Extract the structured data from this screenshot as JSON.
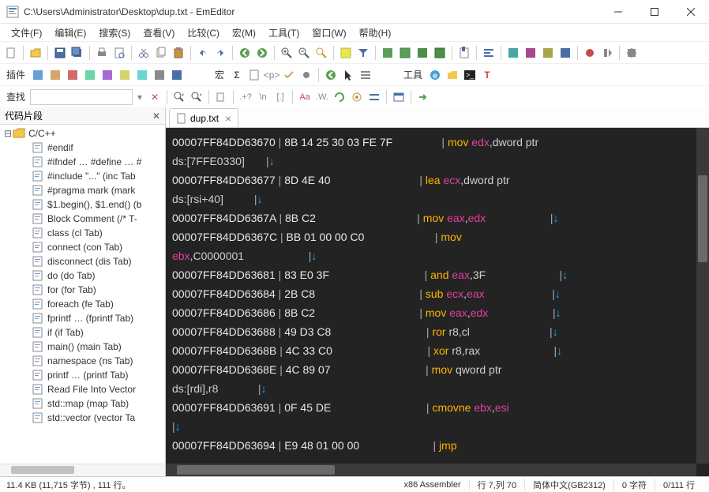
{
  "window": {
    "title": "C:\\Users\\Administrator\\Desktop\\dup.txt - EmEditor"
  },
  "menu": {
    "file": "文件(F)",
    "edit": "编辑(E)",
    "search": "搜索(S)",
    "view": "查看(V)",
    "compare": "比较(C)",
    "macro": "宏(M)",
    "tools": "工具(T)",
    "window": "窗口(W)",
    "help": "帮助(H)"
  },
  "toolbar2": {
    "plugin_label": "插件",
    "macro_label": "宏",
    "tools_label": "工具"
  },
  "toolbar3": {
    "find_label": "查找"
  },
  "snippets": {
    "header": "代码片段",
    "root": "C/C++",
    "items": [
      "#endif",
      "#ifndef … #define … #",
      "#include \"...\"  (inc Tab",
      "#pragma mark  (mark",
      "$1.begin(), $1.end()  (b",
      "Block Comment  (/* T-",
      "class  (cl Tab)",
      "connect  (con Tab)",
      "disconnect  (dis Tab)",
      "do  (do Tab)",
      "for  (for Tab)",
      "foreach  (fe Tab)",
      "fprintf …  (fprintf Tab)",
      "if  (if Tab)",
      "main()  (main Tab)",
      "namespace  (ns Tab)",
      "printf …  (printf Tab)",
      "Read File Into Vector",
      "std::map  (map Tab)",
      "std::vector  (vector Ta"
    ]
  },
  "tab": {
    "name": "dup.txt"
  },
  "editor_lines": [
    [
      {
        "t": "00007FF84DD63670 ",
        "c": "addr"
      },
      {
        "t": "| ",
        "c": "pipe"
      },
      {
        "t": "8B 14 25 30 03 FE 7F",
        "c": "hex"
      },
      {
        "t": "                | ",
        "c": "pipe"
      },
      {
        "t": "mov",
        "c": "mnm"
      },
      {
        "t": " ",
        "c": "lit"
      },
      {
        "t": "edx",
        "c": "reg"
      },
      {
        "t": ",dword ptr",
        "c": "mem"
      }
    ],
    [
      {
        "t": "ds:[7FFE0330]",
        "c": "mem"
      },
      {
        "t": "       |",
        "c": "pipe"
      },
      {
        "t": "↓",
        "c": "arr"
      }
    ],
    [
      {
        "t": "00007FF84DD63677 ",
        "c": "addr"
      },
      {
        "t": "| ",
        "c": "pipe"
      },
      {
        "t": "8D 4E 40",
        "c": "hex"
      },
      {
        "t": "                             | ",
        "c": "pipe"
      },
      {
        "t": "lea",
        "c": "mnm"
      },
      {
        "t": " ",
        "c": "lit"
      },
      {
        "t": "ecx",
        "c": "reg"
      },
      {
        "t": ",dword ptr",
        "c": "mem"
      }
    ],
    [
      {
        "t": "ds:[rsi+40]",
        "c": "mem"
      },
      {
        "t": "          |",
        "c": "pipe"
      },
      {
        "t": "↓",
        "c": "arr"
      }
    ],
    [
      {
        "t": "00007FF84DD6367A ",
        "c": "addr"
      },
      {
        "t": "| ",
        "c": "pipe"
      },
      {
        "t": "8B C2",
        "c": "hex"
      },
      {
        "t": "                                 | ",
        "c": "pipe"
      },
      {
        "t": "mov",
        "c": "mnm"
      },
      {
        "t": " ",
        "c": "lit"
      },
      {
        "t": "eax",
        "c": "reg"
      },
      {
        "t": ",",
        "c": "lit"
      },
      {
        "t": "edx",
        "c": "reg"
      },
      {
        "t": "                     |",
        "c": "pipe"
      },
      {
        "t": "↓",
        "c": "arr"
      }
    ],
    [
      {
        "t": "00007FF84DD6367C ",
        "c": "addr"
      },
      {
        "t": "| ",
        "c": "pipe"
      },
      {
        "t": "BB 01 00 00 C0",
        "c": "hex"
      },
      {
        "t": "                       | ",
        "c": "pipe"
      },
      {
        "t": "mov",
        "c": "mnm"
      }
    ],
    [
      {
        "t": "ebx",
        "c": "reg"
      },
      {
        "t": ",C0000001",
        "c": "lit"
      },
      {
        "t": "                     |",
        "c": "pipe"
      },
      {
        "t": "↓",
        "c": "arr"
      }
    ],
    [
      {
        "t": "00007FF84DD63681 ",
        "c": "addr"
      },
      {
        "t": "| ",
        "c": "pipe"
      },
      {
        "t": "83 E0 3F",
        "c": "hex"
      },
      {
        "t": "                               | ",
        "c": "pipe"
      },
      {
        "t": "and",
        "c": "mnm"
      },
      {
        "t": " ",
        "c": "lit"
      },
      {
        "t": "eax",
        "c": "reg"
      },
      {
        "t": ",3F",
        "c": "lit"
      },
      {
        "t": "                        |",
        "c": "pipe"
      },
      {
        "t": "↓",
        "c": "arr"
      }
    ],
    [
      {
        "t": "00007FF84DD63684 ",
        "c": "addr"
      },
      {
        "t": "| ",
        "c": "pipe"
      },
      {
        "t": "2B C8",
        "c": "hex"
      },
      {
        "t": "                                  | ",
        "c": "pipe"
      },
      {
        "t": "sub",
        "c": "mnm"
      },
      {
        "t": " ",
        "c": "lit"
      },
      {
        "t": "ecx",
        "c": "reg"
      },
      {
        "t": ",",
        "c": "lit"
      },
      {
        "t": "eax",
        "c": "reg"
      },
      {
        "t": "                      |",
        "c": "pipe"
      },
      {
        "t": "↓",
        "c": "arr"
      }
    ],
    [
      {
        "t": "00007FF84DD63686 ",
        "c": "addr"
      },
      {
        "t": "| ",
        "c": "pipe"
      },
      {
        "t": "8B C2",
        "c": "hex"
      },
      {
        "t": "                                  | ",
        "c": "pipe"
      },
      {
        "t": "mov",
        "c": "mnm"
      },
      {
        "t": " ",
        "c": "lit"
      },
      {
        "t": "eax",
        "c": "reg"
      },
      {
        "t": ",",
        "c": "lit"
      },
      {
        "t": "edx",
        "c": "reg"
      },
      {
        "t": "                     |",
        "c": "pipe"
      },
      {
        "t": "↓",
        "c": "arr"
      }
    ],
    [
      {
        "t": "00007FF84DD63688 ",
        "c": "addr"
      },
      {
        "t": "| ",
        "c": "pipe"
      },
      {
        "t": "49 D3 C8",
        "c": "hex"
      },
      {
        "t": "                               | ",
        "c": "pipe"
      },
      {
        "t": "ror",
        "c": "mnm"
      },
      {
        "t": " r8,cl",
        "c": "lit"
      },
      {
        "t": "                          |",
        "c": "pipe"
      },
      {
        "t": "↓",
        "c": "arr"
      }
    ],
    [
      {
        "t": "00007FF84DD6368B ",
        "c": "addr"
      },
      {
        "t": "| ",
        "c": "pipe"
      },
      {
        "t": "4C 33 C0",
        "c": "hex"
      },
      {
        "t": "                               | ",
        "c": "pipe"
      },
      {
        "t": "xor",
        "c": "mnm"
      },
      {
        "t": " r8,rax",
        "c": "lit"
      },
      {
        "t": "                        |",
        "c": "pipe"
      },
      {
        "t": "↓",
        "c": "arr"
      }
    ],
    [
      {
        "t": "00007FF84DD6368E ",
        "c": "addr"
      },
      {
        "t": "| ",
        "c": "pipe"
      },
      {
        "t": "4C 89 07",
        "c": "hex"
      },
      {
        "t": "                               | ",
        "c": "pipe"
      },
      {
        "t": "mov",
        "c": "mnm"
      },
      {
        "t": " qword ptr",
        "c": "mem"
      }
    ],
    [
      {
        "t": "ds:[rdi]",
        "c": "mem"
      },
      {
        "t": ",r8",
        "c": "lit"
      },
      {
        "t": "             |",
        "c": "pipe"
      },
      {
        "t": "↓",
        "c": "arr"
      }
    ],
    [
      {
        "t": "00007FF84DD63691 ",
        "c": "addr"
      },
      {
        "t": "| ",
        "c": "pipe"
      },
      {
        "t": "0F 45 DE",
        "c": "hex"
      },
      {
        "t": "                               | ",
        "c": "pipe"
      },
      {
        "t": "cmovne",
        "c": "mnm"
      },
      {
        "t": " ",
        "c": "lit"
      },
      {
        "t": "ebx",
        "c": "reg"
      },
      {
        "t": ",",
        "c": "lit"
      },
      {
        "t": "esi",
        "c": "reg"
      }
    ],
    [
      {
        "t": "|",
        "c": "pipe"
      },
      {
        "t": "↓",
        "c": "arr"
      }
    ],
    [
      {
        "t": "00007FF84DD63694 ",
        "c": "addr"
      },
      {
        "t": "| ",
        "c": "pipe"
      },
      {
        "t": "E9 48 01 00 00",
        "c": "hex"
      },
      {
        "t": "                        | ",
        "c": "pipe"
      },
      {
        "t": "jmp",
        "c": "mnm"
      }
    ]
  ],
  "status": {
    "size": "11.4 KB (11,715 字节) , 111 行。",
    "lang": "x86 Assembler",
    "pos": "行 7,列 70",
    "enc": "简体中文(GB2312)",
    "chars": "0 字符",
    "lines": "0/111 行"
  }
}
